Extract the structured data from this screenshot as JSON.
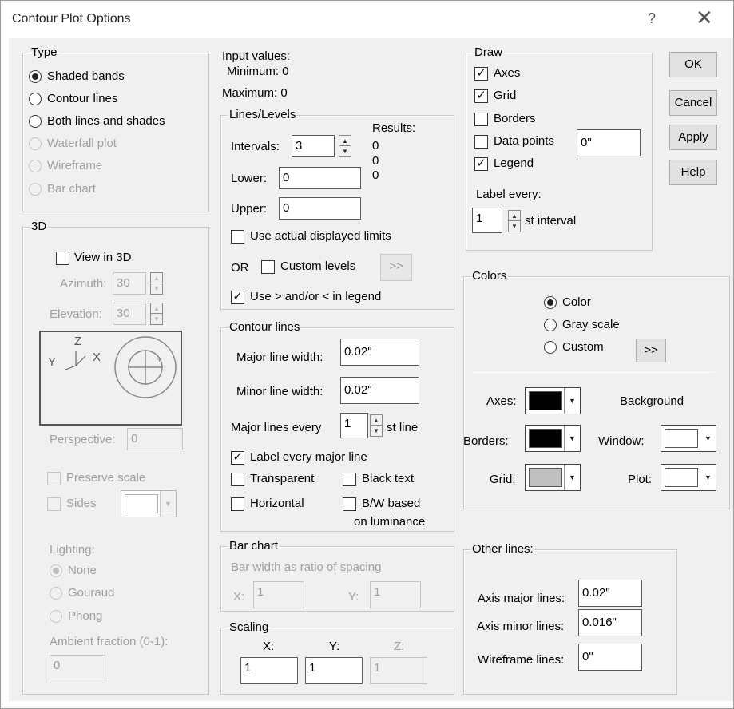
{
  "window": {
    "title": "Contour Plot Options",
    "help_glyph": "?",
    "close_glyph": "✕"
  },
  "type": {
    "title": "Type",
    "shaded": "Shaded bands",
    "contour": "Contour lines",
    "both": "Both lines and shades",
    "waterfall": "Waterfall plot",
    "wireframe": "Wireframe",
    "barchart": "Bar chart",
    "selected": "Shaded bands"
  },
  "td": {
    "title": "3D",
    "view3d": "View in 3D",
    "azimuth_label": "Azimuth:",
    "azimuth": "30",
    "elevation_label": "Elevation:",
    "elevation": "30",
    "axis_z": "Z",
    "axis_y": "Y",
    "axis_x": "X",
    "perspective_label": "Perspective:",
    "perspective": "0",
    "preserve": "Preserve scale",
    "sides": "Sides",
    "lighting": "Lighting:",
    "none": "None",
    "gouraud": "Gouraud",
    "phong": "Phong",
    "ambient_label": "Ambient fraction (0-1):",
    "ambient": "0"
  },
  "input": {
    "label": "Input values:",
    "min": "Minimum: 0",
    "max": "Maximum: 0"
  },
  "lines": {
    "title": "Lines/Levels",
    "results": "Results:",
    "r1": "0",
    "r2": "0",
    "r3": "0",
    "intervals_label": "Intervals:",
    "intervals": "3",
    "lower_label": "Lower:",
    "lower": "0",
    "upper_label": "Upper:",
    "upper": "0",
    "actual": "Use actual displayed limits",
    "or": "OR",
    "custom": "Custom levels",
    "more": ">>",
    "legend": "Use > and/or < in legend"
  },
  "contour": {
    "title": "Contour lines",
    "major_w_label": "Major line width:",
    "major_w": "0.02\"",
    "minor_w_label": "Minor line width:",
    "minor_w": "0.02\"",
    "major_every": "Major lines every",
    "major_every_val": "1",
    "st_line": "st line",
    "label_major": "Label every major line",
    "transparent": "Transparent",
    "black": "Black text",
    "horizontal": "Horizontal",
    "bw1": "B/W based",
    "bw2": "on luminance"
  },
  "bar": {
    "title": "Bar chart",
    "ratio": "Bar width as ratio of spacing",
    "x_label": "X:",
    "x": "1",
    "y_label": "Y:",
    "y": "1"
  },
  "scaling": {
    "title": "Scaling",
    "x_label": "X:",
    "y_label": "Y:",
    "z_label": "Z:",
    "x": "1",
    "y": "1",
    "z": "1"
  },
  "draw": {
    "title": "Draw",
    "axes": "Axes",
    "grid": "Grid",
    "borders": "Borders",
    "datapoints": "Data points",
    "datapoints_val": "0\"",
    "legend": "Legend",
    "label_every": "Label every:",
    "label_every_val": "1",
    "st_interval": "st interval"
  },
  "buttons": {
    "ok": "OK",
    "cancel": "Cancel",
    "apply": "Apply",
    "help": "Help"
  },
  "colors": {
    "title": "Colors",
    "color": "Color",
    "gray": "Gray scale",
    "custom": "Custom",
    "more": ">>",
    "axes": "Axes:",
    "borders": "Borders:",
    "grid": "Grid:",
    "background": "Background",
    "window": "Window:",
    "plot": "Plot:",
    "axes_color": "#000000",
    "borders_color": "#000000",
    "grid_color": "#c0c0c0",
    "window_color": "#ffffff",
    "plot_color": "#ffffff",
    "sides_color": "#ffffff"
  },
  "other": {
    "title": "Other lines:",
    "axis_major_label": "Axis major lines:",
    "axis_major": "0.02\"",
    "axis_minor_label": "Axis minor lines:",
    "axis_minor": "0.016\"",
    "wire_label": "Wireframe lines:",
    "wire": "0\""
  }
}
